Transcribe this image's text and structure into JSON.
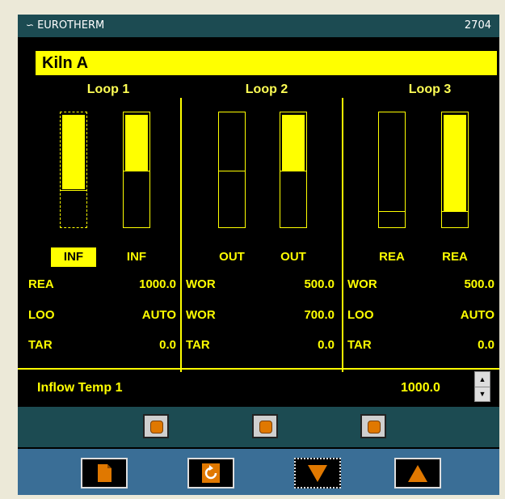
{
  "titlebar": {
    "brand": "EUROTHERM",
    "model": "2704"
  },
  "header": {
    "title": "Kiln A"
  },
  "loops": [
    {
      "name": "Loop 1"
    },
    {
      "name": "Loop 2"
    },
    {
      "name": "Loop 3"
    }
  ],
  "bars": [
    {
      "label": "INF",
      "selected": true,
      "fill_fraction": 0.66,
      "mark_fraction": 0.33
    },
    {
      "label": "INF",
      "selected": false,
      "fill_fraction": 0.5,
      "mark_fraction": 0.5
    },
    {
      "label": "OUT",
      "selected": false,
      "fill_fraction": 0.0,
      "mark_fraction": 0.5
    },
    {
      "label": "OUT",
      "selected": false,
      "fill_fraction": 0.5,
      "mark_fraction": 0.5
    },
    {
      "label": "REA",
      "selected": false,
      "fill_fraction": 0.0,
      "mark_fraction": 0.15
    },
    {
      "label": "REA",
      "selected": false,
      "fill_fraction": 0.85,
      "mark_fraction": 0.15
    }
  ],
  "params": [
    [
      {
        "label": "REA",
        "value": "1000.0"
      },
      {
        "label": "LOO",
        "value": "AUTO"
      },
      {
        "label": "TAR",
        "value": "0.0"
      }
    ],
    [
      {
        "label": "WOR",
        "value": "500.0"
      },
      {
        "label": "WOR",
        "value": "700.0"
      },
      {
        "label": "TAR",
        "value": "0.0"
      }
    ],
    [
      {
        "label": "WOR",
        "value": "500.0"
      },
      {
        "label": "LOO",
        "value": "AUTO"
      },
      {
        "label": "TAR",
        "value": "0.0"
      }
    ]
  ],
  "status": {
    "label": "Inflow Temp 1",
    "value": "1000.0"
  },
  "colors": {
    "accent": "#ffff00",
    "panel": "#1c4b52",
    "button_band": "#3a6e96",
    "button_icon": "#e07800"
  },
  "buttons": {
    "small": [
      "dot-button-1",
      "dot-button-2",
      "dot-button-3"
    ],
    "big": [
      {
        "icon": "page-icon"
      },
      {
        "icon": "refresh-icon"
      },
      {
        "icon": "arrow-down-icon"
      },
      {
        "icon": "arrow-up-icon"
      }
    ]
  }
}
